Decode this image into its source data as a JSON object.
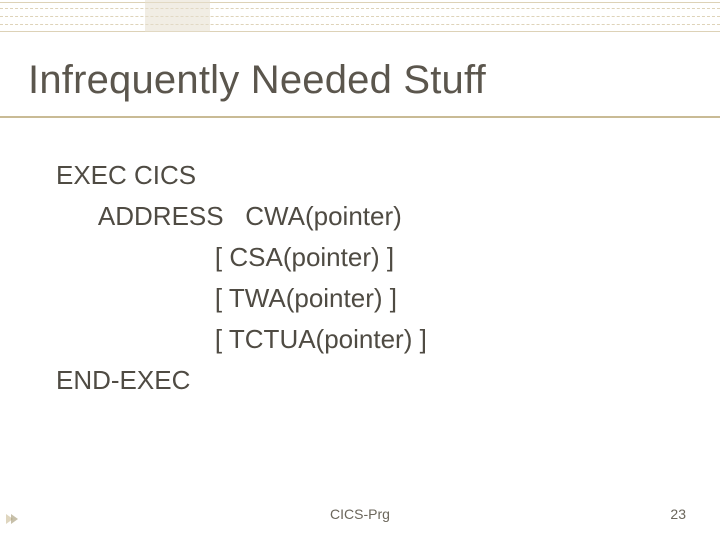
{
  "title": "Infrequently Needed Stuff",
  "code": {
    "l1": "EXEC CICS",
    "l2": "      ADDRESS   CWA(pointer)",
    "l3": "                      [ CSA(pointer) ]",
    "l4": "                      [ TWA(pointer) ]",
    "l5": "                      [ TCTUA(pointer) ]",
    "l6": "END-EXEC"
  },
  "footer": {
    "center": "CICS-Prg",
    "page": "23"
  }
}
